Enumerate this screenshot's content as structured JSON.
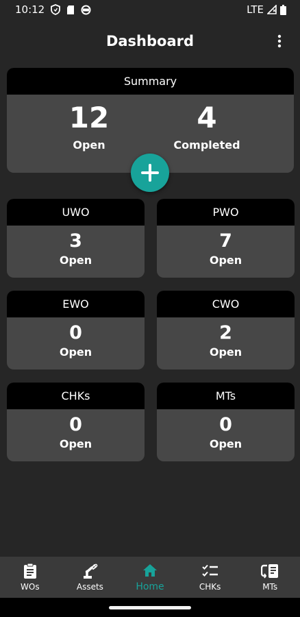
{
  "status_bar": {
    "time": "10:12",
    "network": "LTE"
  },
  "app_bar": {
    "title": "Dashboard"
  },
  "summary": {
    "header": "Summary",
    "open_count": "12",
    "open_label": "Open",
    "completed_count": "4",
    "completed_label": "Completed"
  },
  "cards": [
    {
      "header": "UWO",
      "count": "3",
      "label": "Open"
    },
    {
      "header": "PWO",
      "count": "7",
      "label": "Open"
    },
    {
      "header": "EWO",
      "count": "0",
      "label": "Open"
    },
    {
      "header": "CWO",
      "count": "2",
      "label": "Open"
    },
    {
      "header": "CHKs",
      "count": "0",
      "label": "Open"
    },
    {
      "header": "MTs",
      "count": "0",
      "label": "Open"
    }
  ],
  "bottom_nav": {
    "items": [
      {
        "label": "WOs",
        "icon": "clipboard-icon"
      },
      {
        "label": "Assets",
        "icon": "robot-arm-icon"
      },
      {
        "label": "Home",
        "icon": "home-icon"
      },
      {
        "label": "CHKs",
        "icon": "checklist-icon"
      },
      {
        "label": "MTs",
        "icon": "meter-transfer-icon"
      }
    ],
    "active_index": 2
  },
  "colors": {
    "accent": "#18a39a",
    "background": "#262626",
    "card_body": "#474747",
    "card_header": "#000000",
    "nav_background": "#3a3a3a"
  }
}
